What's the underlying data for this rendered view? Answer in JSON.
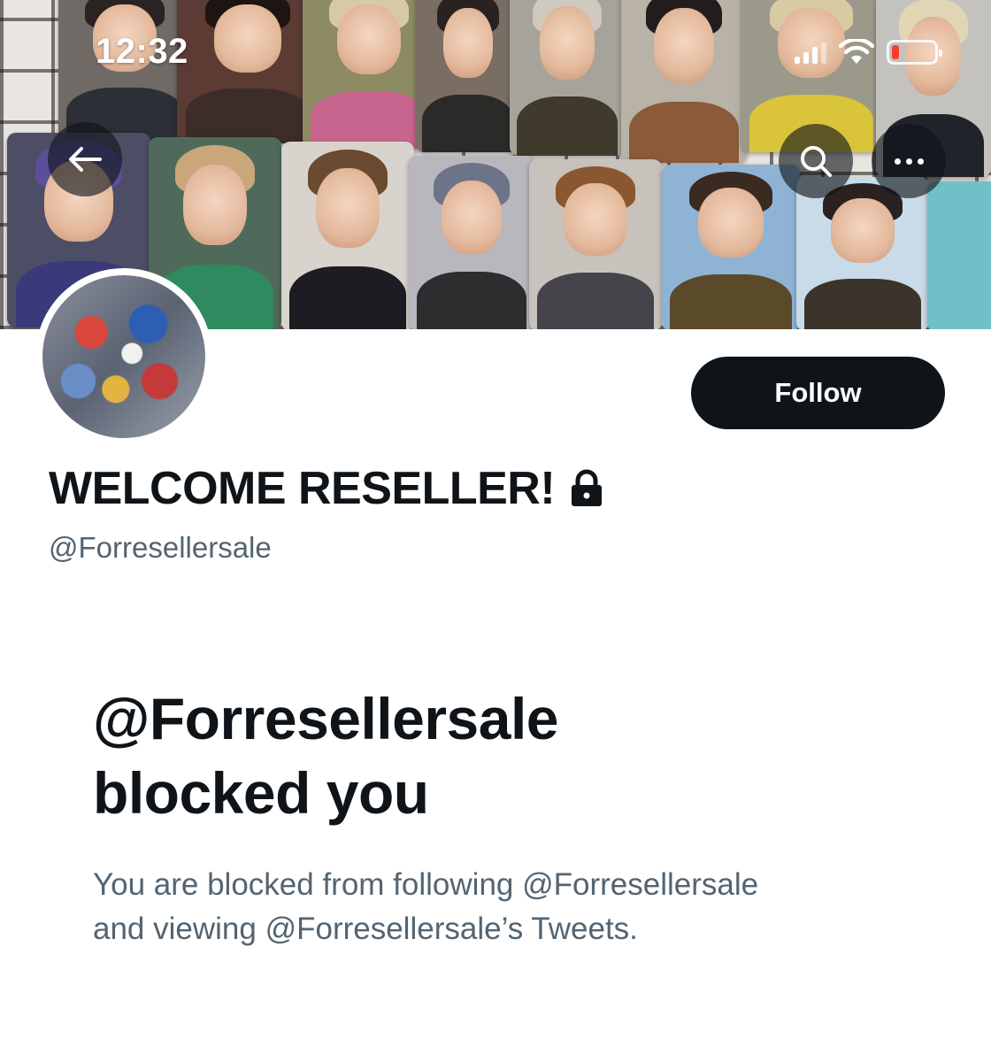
{
  "status_bar": {
    "time": "12:32"
  },
  "header": {
    "back_icon": "arrow-left-icon",
    "search_icon": "search-icon",
    "more_icon": "more-dots-icon"
  },
  "profile": {
    "display_name": "WELCOME RESELLER!",
    "protected_icon": "lock-icon",
    "handle": "@Forresellersale",
    "follow_label": "Follow"
  },
  "blocked": {
    "title_line1": "@Forresellersale",
    "title_line2": "blocked you",
    "description_line1": "You are blocked from following @Forresellersale",
    "description_line2": "and viewing @Forresellersale’s Tweets."
  },
  "colors": {
    "primary_text": "#0f1419",
    "secondary_text": "#536471",
    "button_bg": "#0f1419",
    "battery_low": "#ff3b30"
  }
}
